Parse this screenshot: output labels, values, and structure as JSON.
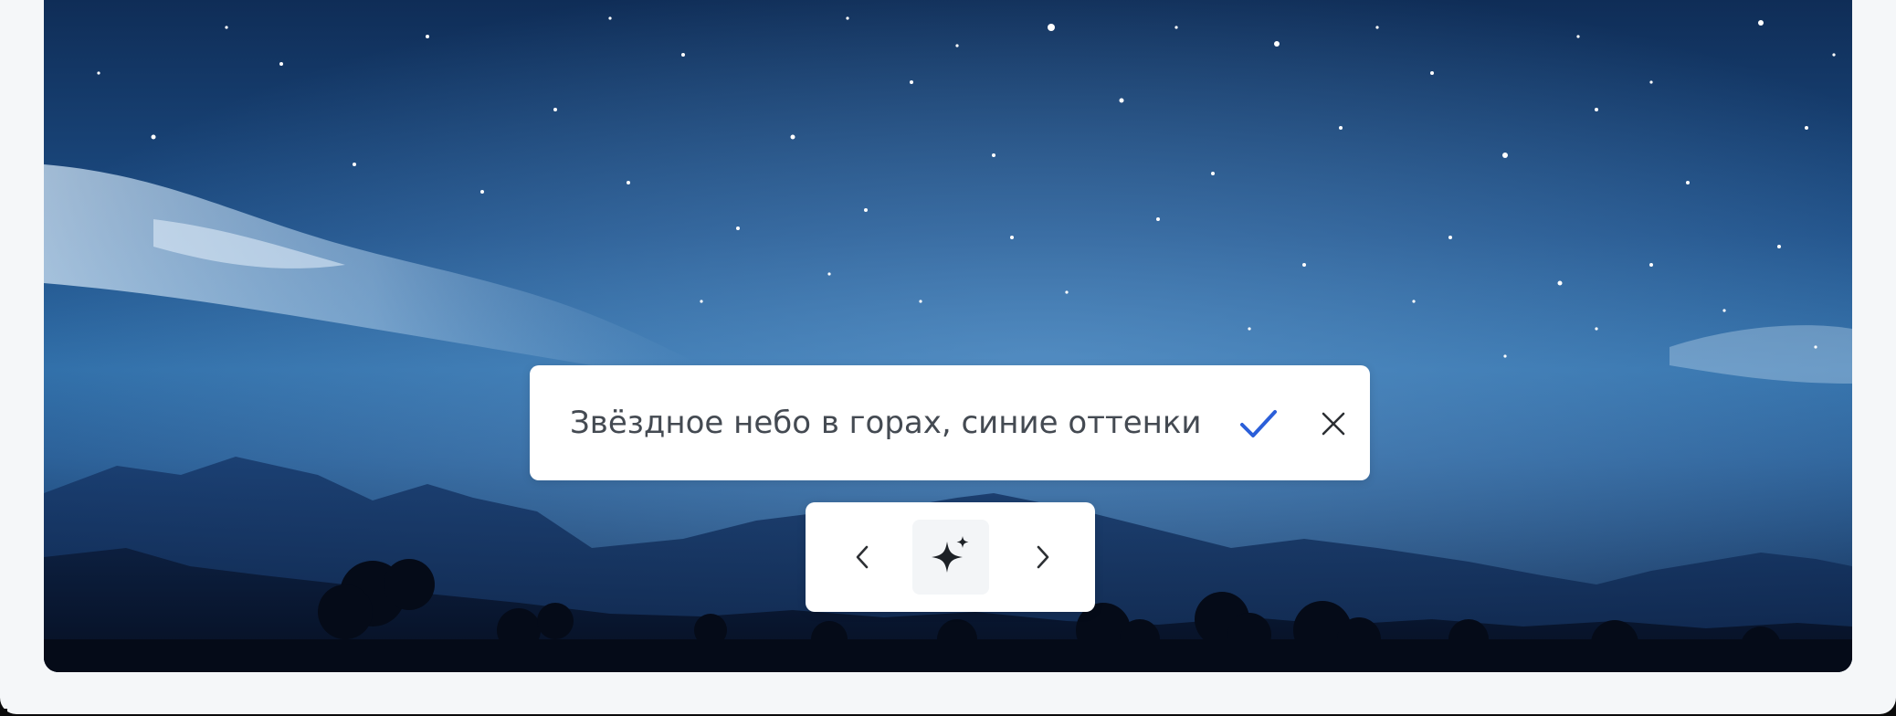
{
  "editor": {
    "prompt_text": "Звёздное небо в горах, синие оттенки",
    "confirm_icon": "check-icon",
    "cancel_icon": "close-icon"
  },
  "navigation": {
    "prev_icon": "chevron-left-icon",
    "generate_icon": "sparkle-icon",
    "next_icon": "chevron-right-icon"
  },
  "colors": {
    "accent": "#2b5fd9",
    "panel_bg": "#ffffff",
    "text": "#444a52",
    "page_bg": "#f5f7f9"
  }
}
